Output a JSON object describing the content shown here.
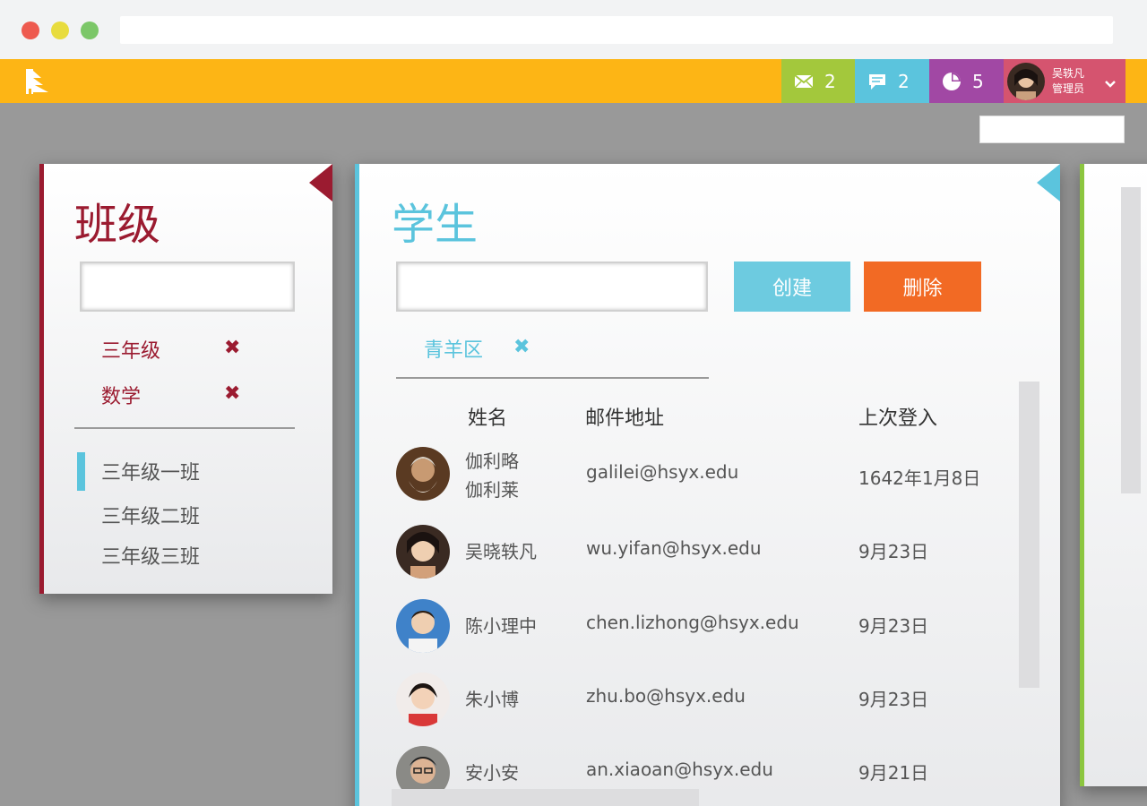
{
  "header": {
    "mail_count": "2",
    "chat_count": "2",
    "chart_count": "5",
    "user_name": "吴轶凡",
    "user_role": "管理员",
    "colors": {
      "bar": "#fdb515",
      "mail": "#a3c83c",
      "chat": "#5bc4dd",
      "chart": "#a148a4",
      "user": "#d5546f"
    }
  },
  "class_panel": {
    "title": "班级",
    "search_value": "",
    "filters": [
      {
        "label": "三年级"
      },
      {
        "label": "数学"
      }
    ],
    "classes": [
      {
        "label": "三年级一班",
        "active": true
      },
      {
        "label": "三年级二班"
      },
      {
        "label": "三年级三班"
      }
    ]
  },
  "student_panel": {
    "title": "学生",
    "search_value": "",
    "create_label": "创建",
    "delete_label": "删除",
    "tag": "青羊区",
    "columns": {
      "name": "姓名",
      "email": "邮件地址",
      "last_login": "上次登入"
    },
    "rows": [
      {
        "name_line1": "伽利略",
        "name_line2": "伽利莱",
        "email": "galilei@hsyx.edu",
        "last_login": "1642年1月8日"
      },
      {
        "name": "吴晓轶凡",
        "email": "wu.yifan@hsyx.edu",
        "last_login": "9月23日"
      },
      {
        "name": "陈小理中",
        "email": "chen.lizhong@hsyx.edu",
        "last_login": "9月23日"
      },
      {
        "name": "朱小博",
        "email": "zhu.bo@hsyx.edu",
        "last_login": "9月23日"
      },
      {
        "name": "安小安",
        "email": "an.xiaoan@hsyx.edu",
        "last_login": "9月21日"
      }
    ]
  }
}
